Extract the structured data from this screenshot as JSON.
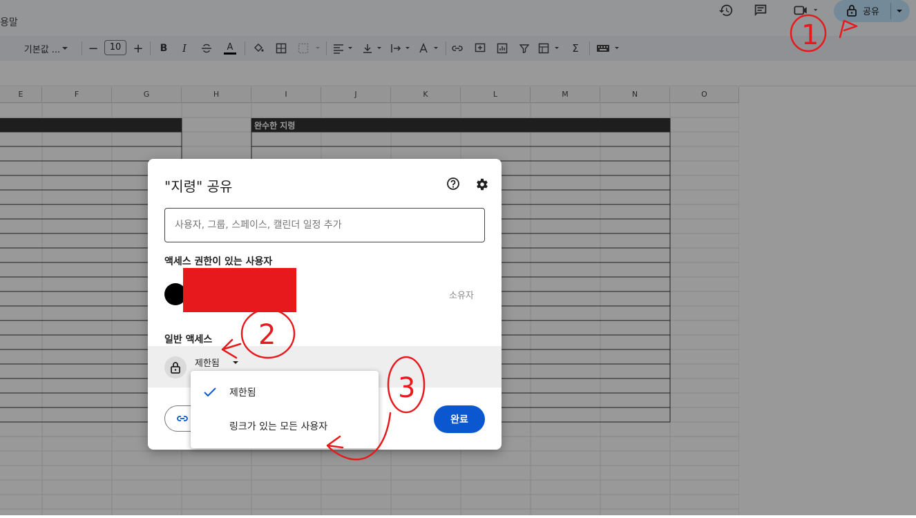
{
  "doc": {
    "name_fragment": "용말"
  },
  "toolbar": {
    "font_label": "기본값 ...",
    "font_size": "10",
    "minus": "−",
    "plus": "+",
    "bold": "B",
    "italic": "I",
    "text_color": "A",
    "sum": "Σ"
  },
  "share_button": {
    "label": "공유"
  },
  "columns": [
    "E",
    "F",
    "G",
    "H",
    "I",
    "J",
    "K",
    "L",
    "M",
    "N",
    "O"
  ],
  "sheet": {
    "band_header": "완수한 지령"
  },
  "dialog": {
    "title": "\"지령\" 공유",
    "add_placeholder": "사용자, 그룹, 스페이스, 캘린더 일정 추가",
    "access_heading": "액세스 권한이 있는 사용자",
    "owner_label": "소유자",
    "general_heading": "일반 액세스",
    "restricted_label": "제한됨",
    "done_label": "완료"
  },
  "menu": {
    "items": [
      {
        "label": "제한됨",
        "selected": true
      },
      {
        "label": "링크가 있는 모든 사용자",
        "selected": false
      }
    ]
  },
  "annotations": {
    "one": "1",
    "two": "2",
    "three": "3"
  },
  "colors": {
    "accent": "#0b57d0",
    "annotation": "#e8191c",
    "share_button_bg": "#c2e7ff"
  }
}
